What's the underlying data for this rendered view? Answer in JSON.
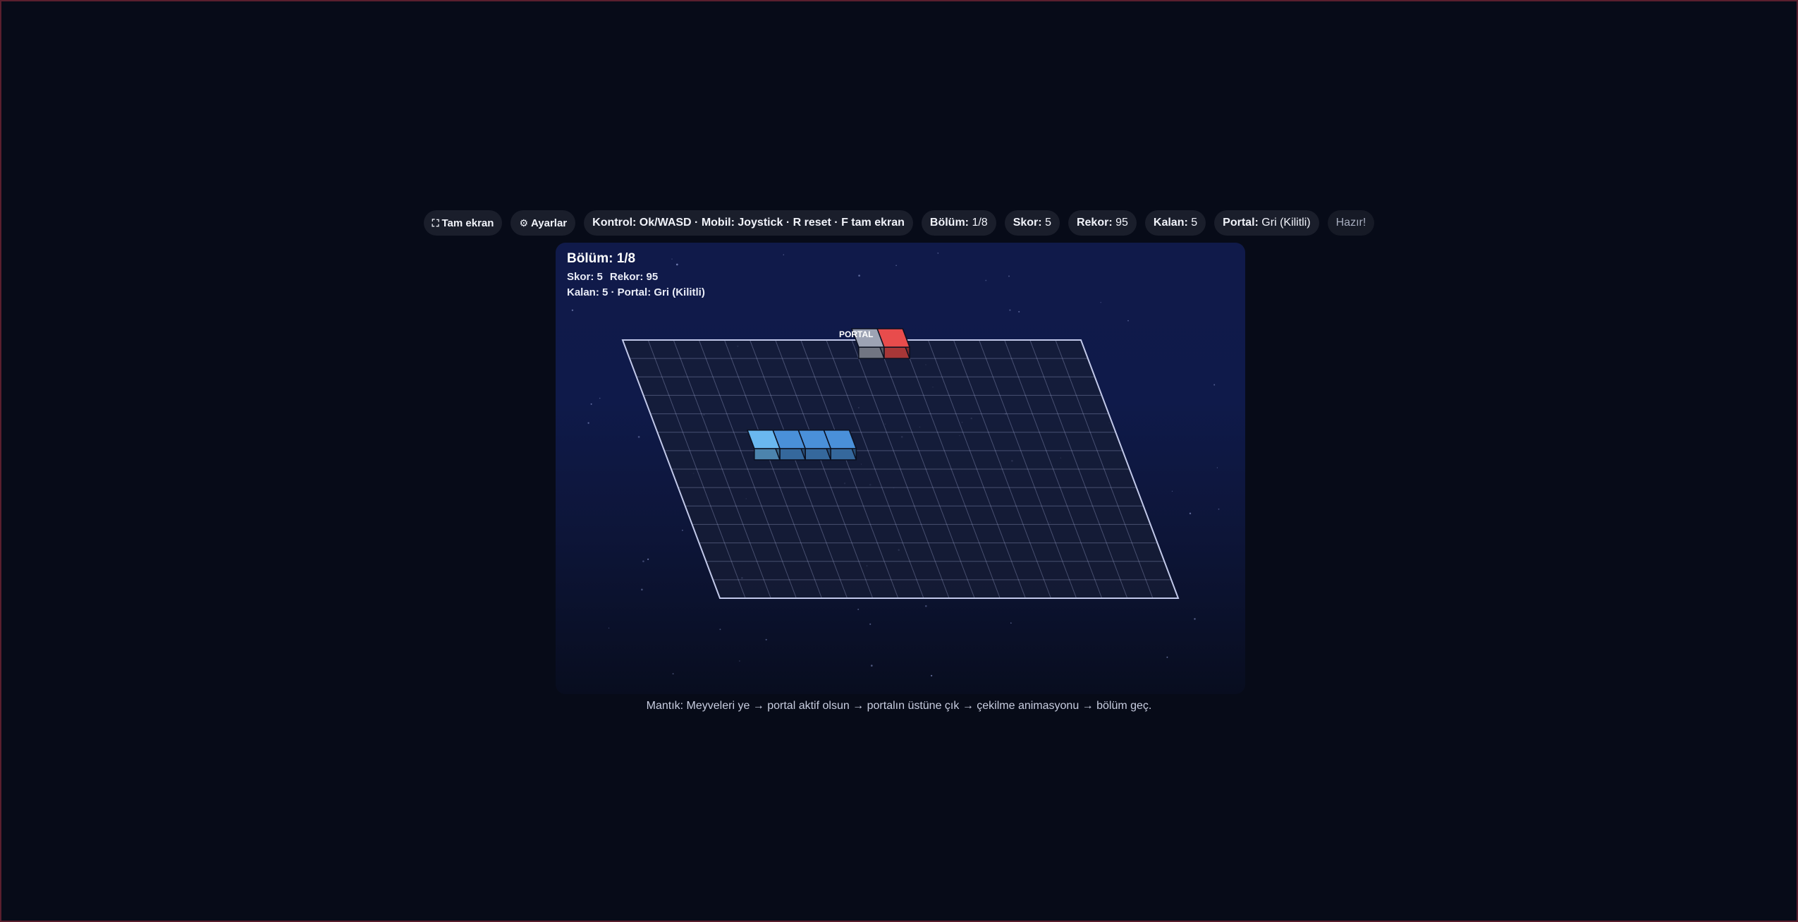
{
  "toolbar": {
    "fullscreen_icon": "fullscreen-icon",
    "fullscreen_label": "Tam ekran",
    "settings_icon": "gear-icon",
    "settings_label": "Ayarlar",
    "controls": "Kontrol: Ok/WASD · Mobil: Joystick · R reset · F tam ekran",
    "level_label": "Bölüm:",
    "level_value": "1/8",
    "score_label": "Skor:",
    "score_value": "5",
    "record_label": "Rekor:",
    "record_value": "95",
    "remaining_label": "Kalan:",
    "remaining_value": "5",
    "portal_label": "Portal:",
    "portal_value": "Gri (Kilitli)",
    "status": "Hazır!"
  },
  "hud": {
    "title": "Bölüm: 1/8",
    "score": "Skor: 5",
    "record": "Rekor: 95",
    "info": "Kalan: 5 · Portal: Gri (Kilitli)"
  },
  "game": {
    "portal_label": "PORTAL",
    "snake_length": 4,
    "colors": {
      "background": "#070b18",
      "grid_line": "#aab3dd",
      "snake_head": "#6ab8f0",
      "snake_body": "#4a90d9",
      "fruit": "#e84c4c",
      "portal_locked": "#9da3b4"
    }
  },
  "footer": {
    "logic": "Mantık: Meyveleri ye → portal aktif olsun → portalın üstüne çık → çekilme animasyonu → bölüm geç."
  }
}
